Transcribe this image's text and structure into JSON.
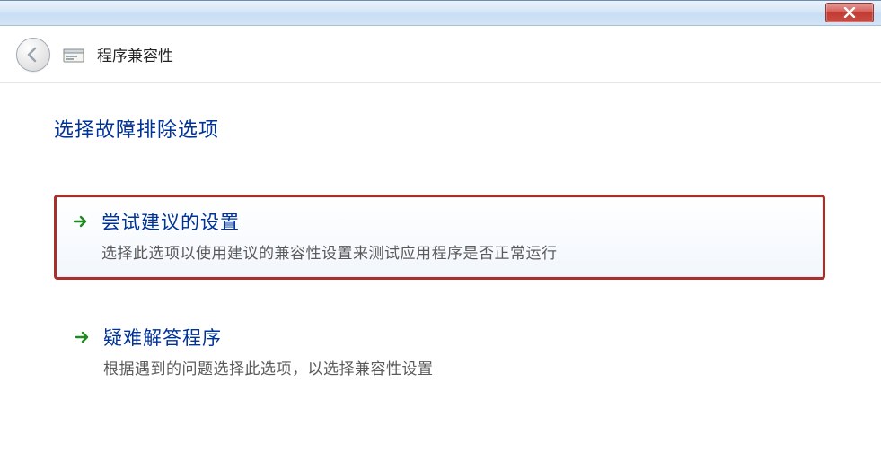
{
  "header": {
    "wizard_title": "程序兼容性"
  },
  "main": {
    "heading": "选择故障排除选项",
    "options": [
      {
        "title": "尝试建议的设置",
        "desc": "选择此选项以使用建议的兼容性设置来测试应用程序是否正常运行"
      },
      {
        "title": "疑难解答程序",
        "desc": "根据遇到的问题选择此选项，以选择兼容性设置"
      }
    ]
  }
}
